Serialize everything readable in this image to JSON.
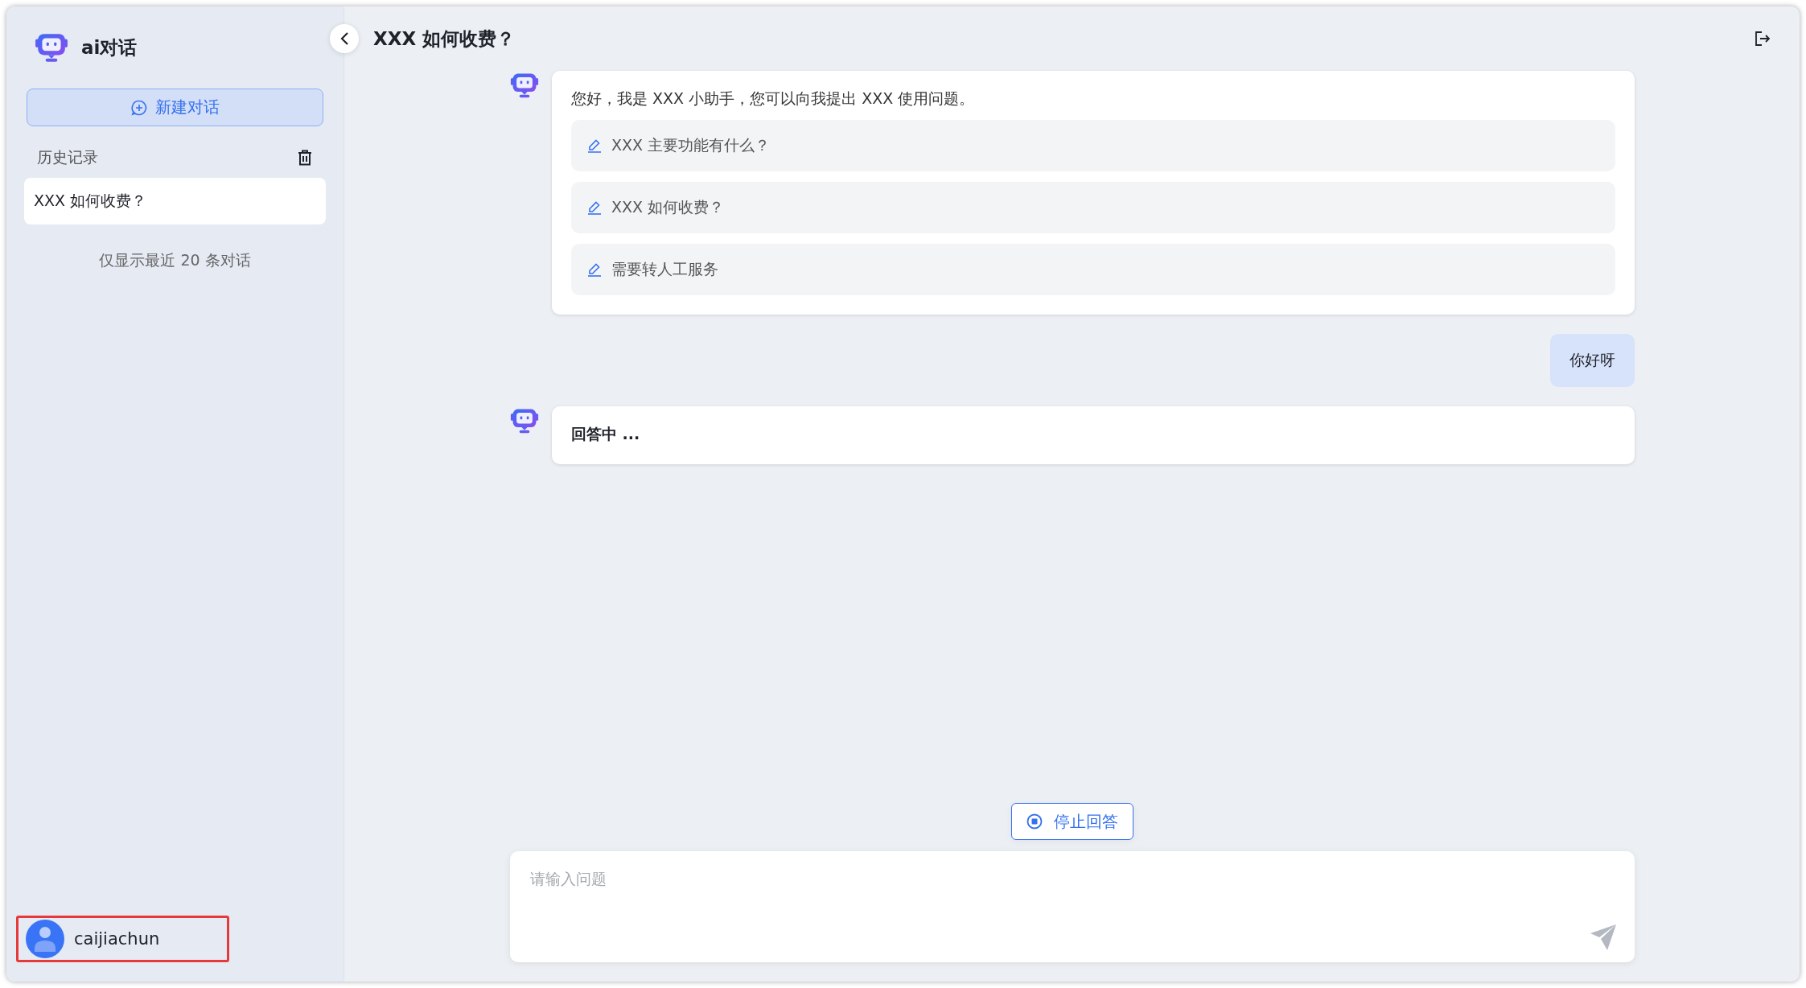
{
  "sidebar": {
    "app_title": "ai对话",
    "new_chat_button": "新建对话",
    "history_label": "历史记录",
    "history_items": [
      {
        "title": "XXX 如何收费？",
        "selected": true
      }
    ],
    "history_note": "仅显示最近 20 条对话",
    "user": {
      "name": "caijiachun"
    }
  },
  "chat": {
    "title": "XXX 如何收费？",
    "messages": [
      {
        "kind": "bot",
        "text": "您好，我是 XXX 小助手，您可以向我提出 XXX 使用问题。",
        "suggestions": [
          "XXX 主要功能有什么？",
          "XXX 如何收费？",
          "需要转人工服务"
        ],
        "pending": false
      },
      {
        "kind": "user",
        "text": "你好呀"
      },
      {
        "kind": "bot",
        "text": "回答中 ...",
        "pending": true
      }
    ],
    "stop_button": "停止回答",
    "input": {
      "placeholder": "请输入问题"
    }
  }
}
